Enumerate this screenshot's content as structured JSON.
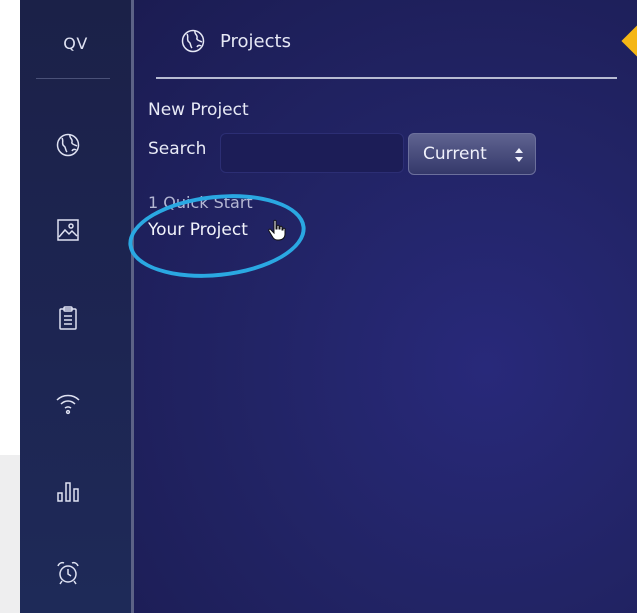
{
  "sidebar": {
    "logo": "QV",
    "items": [
      {
        "icon": "globe-icon"
      },
      {
        "icon": "image-icon"
      },
      {
        "icon": "clipboard-icon"
      },
      {
        "icon": "wifi-icon"
      },
      {
        "icon": "bar-chart-icon"
      },
      {
        "icon": "alarm-clock-icon"
      }
    ]
  },
  "header": {
    "icon": "globe-icon",
    "title": "Projects"
  },
  "main": {
    "new_project_label": "New Project",
    "search_label": "Search",
    "search_value": "",
    "filter_value": "Current",
    "projects": [
      {
        "label": "1 Quick Start"
      },
      {
        "label": "Your Project"
      }
    ]
  },
  "colors": {
    "accent": "#f5b615",
    "highlight": "#2aa8e2",
    "sidebar_bg": "#1d2552",
    "main_bg": "#222466"
  }
}
